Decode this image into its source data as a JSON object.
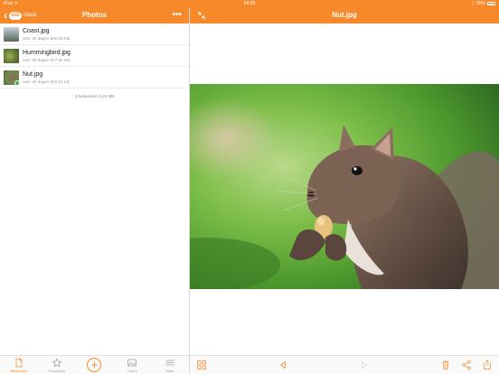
{
  "status_bar": {
    "carrier": "iPad ᯤ",
    "time": "09:28",
    "battery": "55%"
  },
  "left_header": {
    "title": "Photos",
    "logo_text": "GO",
    "back_label": "cloud",
    "more_label": "•••"
  },
  "right_header": {
    "title": "Nut.jpg"
  },
  "files": [
    {
      "name": "Coast.jpg",
      "meta": "over 30 dagen 800,05 KB",
      "thumb": "coast",
      "synced": false
    },
    {
      "name": "Hummingbird.jpg",
      "meta": "over 30 dagen 577,92 KB",
      "thumb": "bird",
      "synced": false
    },
    {
      "name": "Nut.jpg",
      "meta": "over 30 dagen 932,04 KB",
      "thumb": "nut",
      "synced": true
    }
  ],
  "summary": "3 bestanden 2,25 MB",
  "tabs": [
    {
      "label": "Bestanden",
      "icon": "file-icon",
      "active": true
    },
    {
      "label": "Favorieten",
      "icon": "star-icon",
      "active": false
    },
    {
      "label": "",
      "icon": "add-icon",
      "active": false
    },
    {
      "label": "Foto's",
      "icon": "photo-icon",
      "active": false
    },
    {
      "label": "Meer",
      "icon": "menu-icon",
      "active": false
    }
  ],
  "colors": {
    "accent": "#f7892b",
    "synced": "#36b33c"
  }
}
